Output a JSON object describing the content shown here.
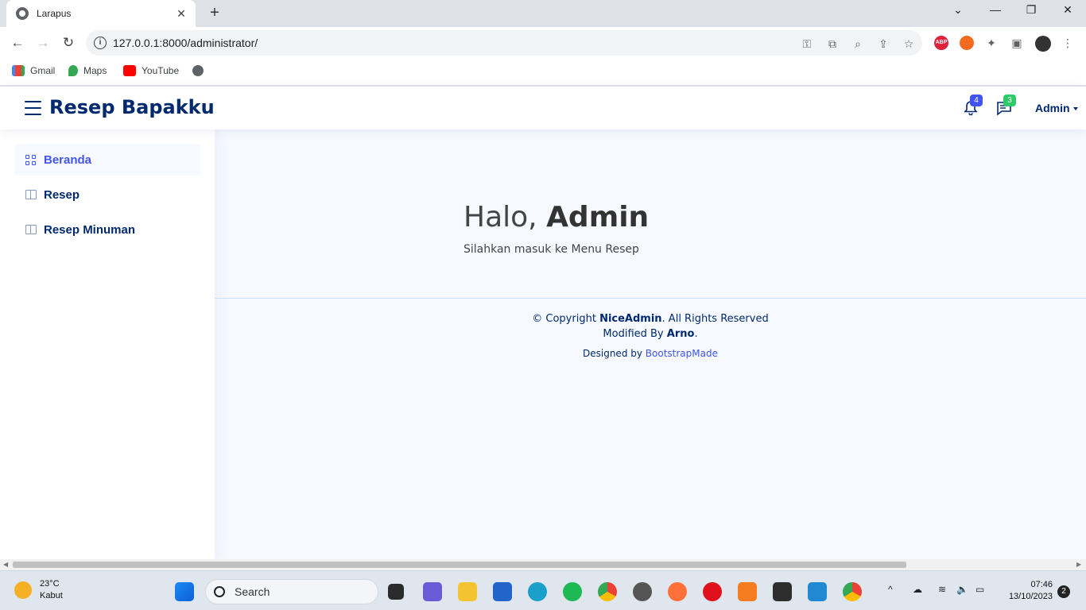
{
  "browser": {
    "tab_title": "Larapus",
    "tab_close": "✕",
    "new_tab": "+",
    "url": "127.0.0.1:8000/administrator/",
    "bookmarks": [
      {
        "label": "Gmail",
        "icon": "gmail-icon"
      },
      {
        "label": "Maps",
        "icon": "maps-icon"
      },
      {
        "label": "YouTube",
        "icon": "youtube-icon"
      }
    ]
  },
  "header": {
    "brand": "Resep Bapakku",
    "notifications_count": "4",
    "messages_count": "3",
    "user_name": "Admin",
    "accent": "#012970"
  },
  "sidebar": {
    "items": [
      {
        "label": "Beranda",
        "icon": "grid-icon",
        "active": true
      },
      {
        "label": "Resep",
        "icon": "book-icon"
      },
      {
        "label": "Resep Minuman",
        "icon": "book-icon"
      }
    ]
  },
  "main": {
    "greeting_prefix": "Halo,",
    "greeting_name": "Admin",
    "subtitle": "Silahkan masuk ke Menu Resep"
  },
  "footer": {
    "copyright_prefix": "© Copyright",
    "copyright_brand": "NiceAdmin",
    "copyright_suffix": ". All Rights Reserved",
    "modified_prefix": "Modified By",
    "modified_name": "Arno",
    "modified_suffix": ".",
    "designed_prefix": "Designed by",
    "designed_link": "BootstrapMade"
  },
  "taskbar": {
    "temperature": "23°C",
    "weather": "Kabut",
    "search_placeholder": "Search",
    "time": "07:46",
    "date": "13/10/2023",
    "notification_count": "2"
  }
}
